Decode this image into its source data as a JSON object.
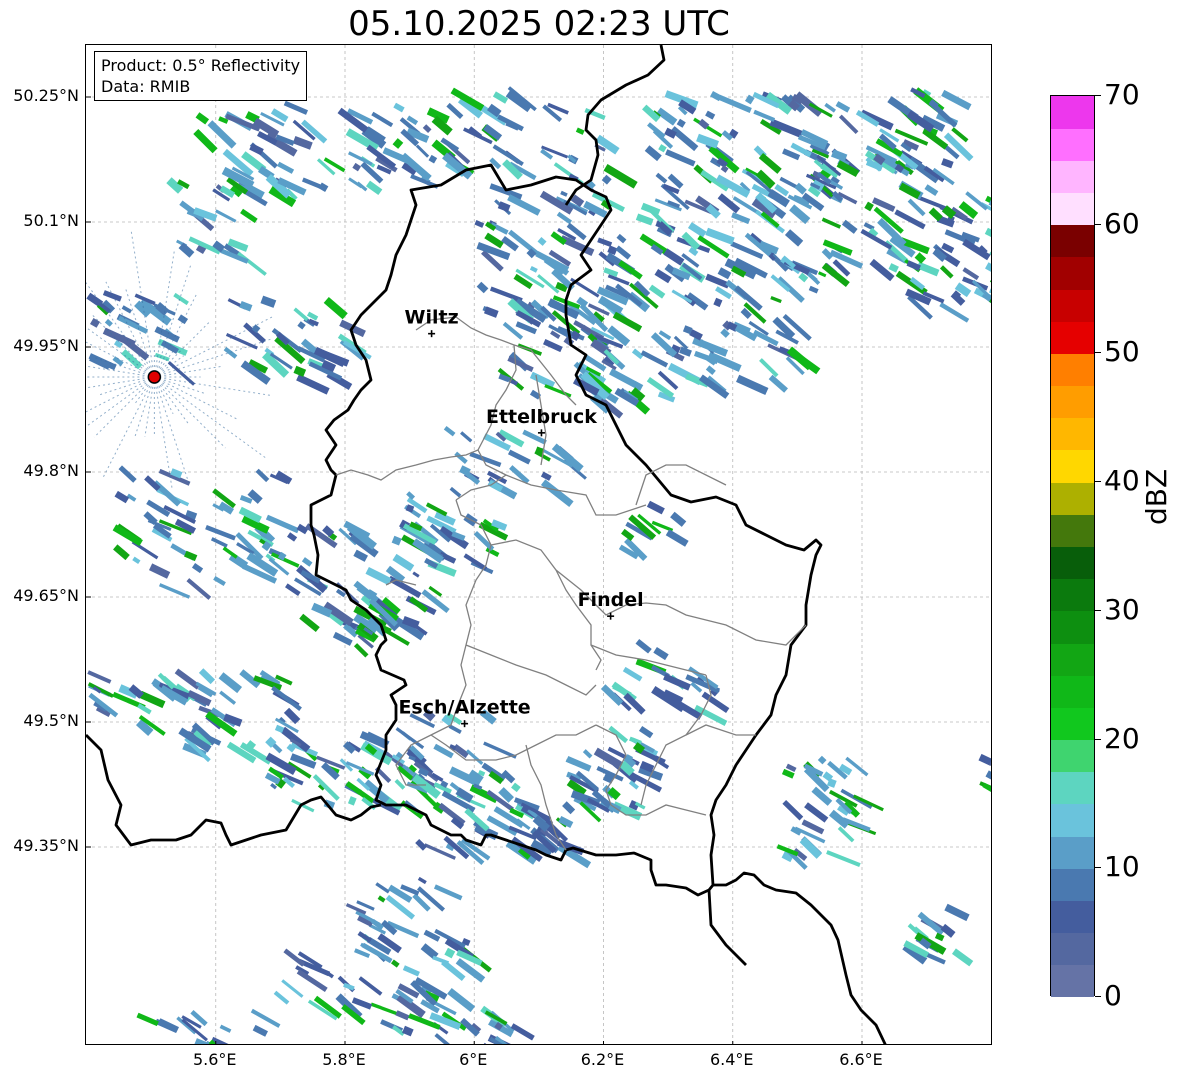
{
  "title": "05.10.2025 02:23 UTC",
  "info": {
    "product": "Product: 0.5° Reflectivity",
    "data": "Data: RMIB"
  },
  "lat_labels": [
    "50.25°N",
    "50.1°N",
    "49.95°N",
    "49.8°N",
    "49.65°N",
    "49.5°N",
    "49.35°N"
  ],
  "lon_labels": [
    "5.6°E",
    "5.8°E",
    "6°E",
    "6.2°E",
    "6.4°E",
    "6.6°E"
  ],
  "cities": [
    {
      "name": "Wiltz",
      "lon": 5.934,
      "lat": 49.966
    },
    {
      "name": "Ettelbruck",
      "lon": 6.104,
      "lat": 49.847
    },
    {
      "name": "Findel",
      "lon": 6.211,
      "lat": 49.627
    },
    {
      "name": "Esch/Alzette",
      "lon": 5.985,
      "lat": 49.498
    }
  ],
  "radar_site": {
    "lon": 5.505,
    "lat": 49.914
  },
  "colorbar": {
    "label": "dBZ",
    "tick_labels": [
      "0",
      "10",
      "20",
      "30",
      "40",
      "50",
      "60",
      "70"
    ],
    "min": 0,
    "max": 70,
    "colors": [
      "#6573a6",
      "#5468a0",
      "#445d9e",
      "#4a79b0",
      "#5a9ec8",
      "#6ac3dc",
      "#5dd5c0",
      "#3fd46f",
      "#11c81e",
      "#10b818",
      "#12a614",
      "#0d8f10",
      "#0b7a0d",
      "#085e0a",
      "#44780c",
      "#adb000",
      "#ffd700",
      "#ffb700",
      "#ff9d00",
      "#ff7f00",
      "#e50000",
      "#c80000",
      "#a10000",
      "#7a0000",
      "#ffdfff",
      "#ffb5ff",
      "#ff6fff",
      "#ed37ed"
    ]
  }
}
